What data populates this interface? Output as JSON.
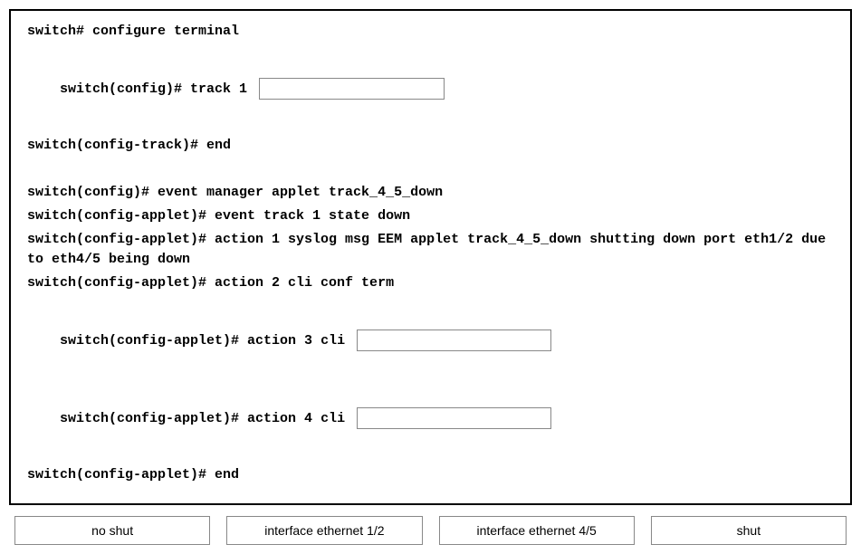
{
  "terminal": {
    "lines": {
      "l1": "switch# configure terminal",
      "l2": "switch(config)# track 1 ",
      "l3": "switch(config-track)# end",
      "l4": "switch(config)# event manager applet track_4_5_down",
      "l5": "switch(config-applet)# event track 1 state down",
      "l6": "switch(config-applet)# action 1 syslog msg EEM applet track_4_5_down shutting down port eth1/2 due to eth4/5 being down",
      "l7": "switch(config-applet)# action 2 cli conf term",
      "l8": "switch(config-applet)# action 3 cli ",
      "l9": "switch(config-applet)# action 4 cli ",
      "l10": "switch(config-applet)# end"
    }
  },
  "options": [
    "no shut",
    "interface ethernet 1/2",
    "interface ethernet 4/5",
    "shut"
  ]
}
